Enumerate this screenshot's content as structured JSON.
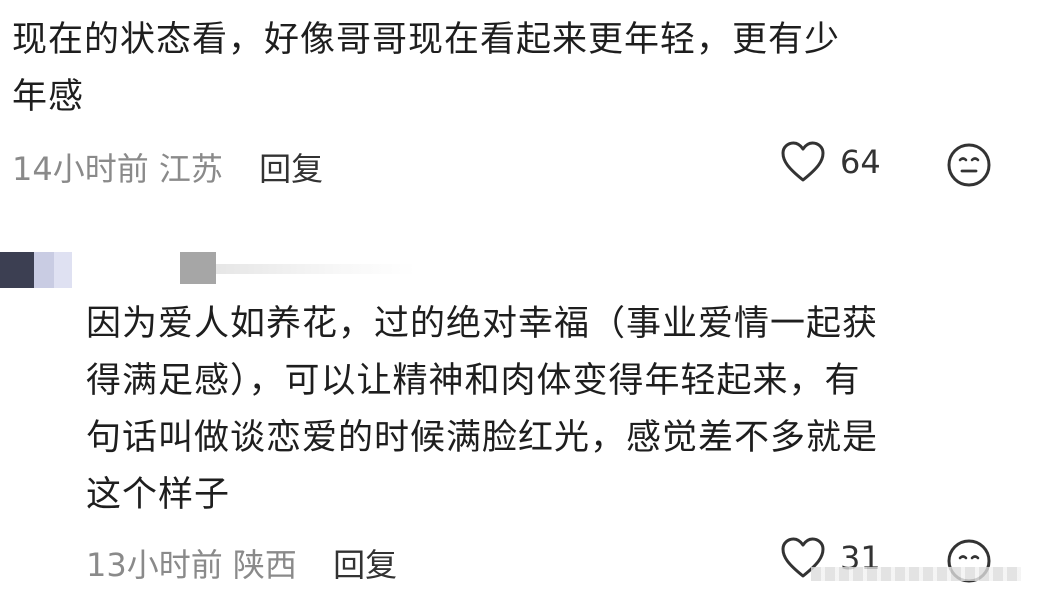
{
  "comments": [
    {
      "text_lines": [
        "现在的状态看，好像哥哥现在看起来更年轻，更有少",
        "年感"
      ],
      "time": "14小时前",
      "location": "江苏",
      "reply_label": "回复",
      "likes": "64",
      "like_icon": "heart-outline-icon",
      "emoji_icon": "neutral-face-icon"
    },
    {
      "text_lines": [
        "因为爱人如养花，过的绝对幸福（事业爱情一起获",
        "得满足感），可以让精神和肉体变得年轻起来，有",
        "句话叫做谈恋爱的时候满脸红光，感觉差不多就是",
        "这个样子"
      ],
      "time": "13小时前",
      "location": "陕西",
      "reply_label": "回复",
      "likes": "31",
      "like_icon": "heart-outline-icon",
      "emoji_icon": "smiling-face-icon"
    }
  ],
  "colors": {
    "text": "#1e1e1e",
    "meta": "#8a8a8a",
    "icon": "#333333"
  }
}
